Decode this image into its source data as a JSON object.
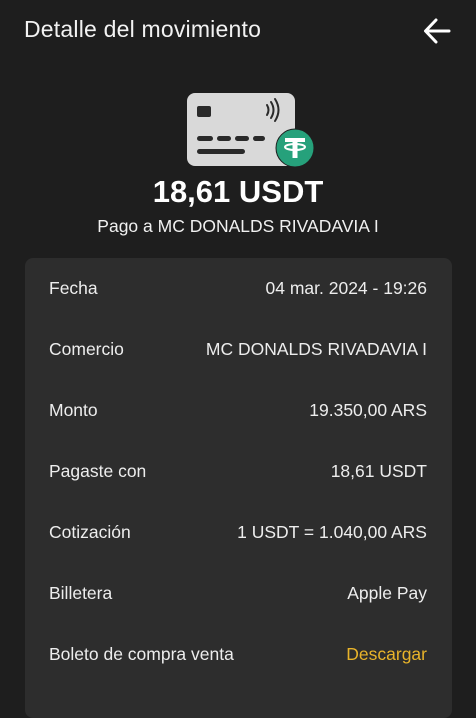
{
  "header": {
    "title": "Detalle del movimiento"
  },
  "hero": {
    "amount": "18,61 USDT",
    "subtitle": "Pago a MC DONALDS RIVADAVIA I",
    "card_icon": "credit-card-contactless-icon",
    "badge_icon": "tether-icon",
    "badge_color": "#26a17b"
  },
  "details": {
    "rows": [
      {
        "label": "Fecha",
        "value": "04 mar. 2024 - 19:26"
      },
      {
        "label": "Comercio",
        "value": "MC DONALDS RIVADAVIA I"
      },
      {
        "label": "Monto",
        "value": "19.350,00 ARS"
      },
      {
        "label": "Pagaste con",
        "value": "18,61 USDT"
      },
      {
        "label": "Cotización",
        "value": "1 USDT = 1.040,00 ARS"
      },
      {
        "label": "Billetera",
        "value": "Apple Pay"
      },
      {
        "label": "Boleto de compra venta",
        "value": "Descargar"
      }
    ]
  },
  "colors": {
    "background": "#1e1e1e",
    "card": "#2d2d2d",
    "accent_link": "#e8b32a"
  }
}
